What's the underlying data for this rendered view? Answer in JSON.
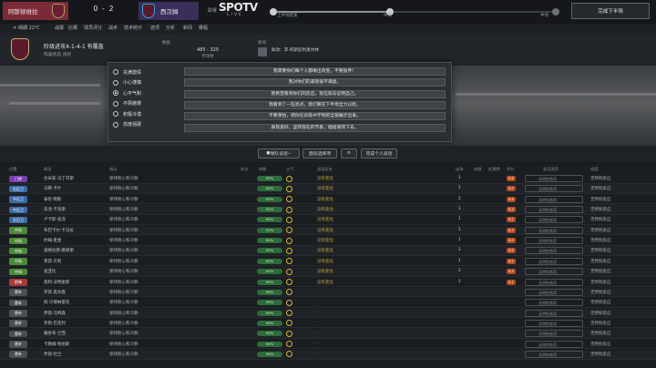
{
  "match": {
    "home_team": "阿斯顿维拉",
    "score": "0 - 2",
    "away_team": "西汉姆",
    "competition": "联赛",
    "broadcaster_top": "SPOTV",
    "broadcaster_bottom": "LIVE",
    "timeline": {
      "first_half": "上半场结束",
      "halftime": "中场",
      "second_half": "半场",
      "progress": 0.41
    },
    "continue_label": "完成下半场"
  },
  "info_bar": {
    "weather": "晴朗 22℃",
    "tabs": [
      "战报",
      "比赛",
      "球员评分",
      "战术",
      "技术统计",
      "选项",
      "分析",
      "新闻",
      "赛程"
    ]
  },
  "team_header": {
    "formation": "阶级进攻4-1-4-1 有覆盖",
    "subtitle": "阵容状态 良好",
    "stat_title": "数据",
    "stat_value": "485 - 325",
    "stat_sub": "传球数",
    "news_title": "新闻",
    "news_text": "助攻：李·阿斯彭利奥尔林"
  },
  "dialog": {
    "options": [
      {
        "label": "充满激情",
        "selected": false
      },
      {
        "label": "小心谨慎",
        "selected": false
      },
      {
        "label": "心平气和",
        "selected": true
      },
      {
        "label": "不屑傲慢",
        "selected": false
      },
      {
        "label": "积极冷漠",
        "selected": false
      },
      {
        "label": "态度强硬",
        "selected": false
      }
    ],
    "talk_lines": [
      "我需要你们每个人都做出改变，不要放弃！",
      "我对你们的表现很不满意。",
      "我希望看到你们的反应，现在就去证明自己。",
      "我看到了一些亮点，我们要在下半场全力以赴。",
      "不要害怕，把你在训练中学到的全部展示出来。",
      "表现良好，坚持现在的节奏，继续保持下去。"
    ]
  },
  "toolbar": {
    "team_talk_label": "球队谈话",
    "individual_label": "面谈选择项",
    "reset_label": "重置",
    "extra_label": "完成个人谈话"
  },
  "table": {
    "headers": [
      "位置",
      "球员",
      "指示",
      "评分",
      "体能",
      "士气",
      "谈话反应",
      "出场",
      "进球",
      "红黄牌",
      "评分",
      "谈话选项",
      "态度"
    ],
    "rows": [
      {
        "pos": "门将",
        "pos_color": "#7a3fb0",
        "name": "达米安·马丁内斯",
        "instruction": "保持耐心和冷静",
        "att": "95%",
        "reaction": "没有变化",
        "n1": "1",
        "badge": "6.8",
        "option": "无特别选项",
        "attitude": "无特别反应"
      },
      {
        "pos": "右后卫",
        "pos_color": "#3a6aa8",
        "name": "马蒂·卡什",
        "instruction": "保持耐心和冷静",
        "att": "94%",
        "reaction": "没有变化",
        "n1": "1",
        "badge": "6.5",
        "option": "无特别选项",
        "attitude": "无特别反应"
      },
      {
        "pos": "中后卫",
        "pos_color": "#3a6aa8",
        "name": "泰伦·明斯",
        "instruction": "保持耐心和冷静",
        "att": "93%",
        "reaction": "没有变化",
        "n1": "1",
        "badge": "6.6",
        "option": "无特别选项",
        "attitude": "无特别反应"
      },
      {
        "pos": "中后卫",
        "pos_color": "#3a6aa8",
        "name": "迭戈·卡洛斯",
        "instruction": "保持耐心和冷静",
        "att": "92%",
        "reaction": "没有变化",
        "n1": "1",
        "badge": "6.4",
        "option": "无特别选项",
        "attitude": "无特别反应"
      },
      {
        "pos": "左后卫",
        "pos_color": "#3a6aa8",
        "name": "卢卡斯·迪涅",
        "instruction": "保持耐心和冷静",
        "att": "95%",
        "reaction": "没有变化",
        "n1": "1",
        "badge": "6.7",
        "option": "无特别选项",
        "attitude": "无特别反应"
      },
      {
        "pos": "中场",
        "pos_color": "#4c8a3a",
        "name": "布巴卡尔·卡马拉",
        "instruction": "保持耐心和冷静",
        "att": "91%",
        "reaction": "没有变化",
        "n1": "1",
        "badge": "6.3",
        "option": "无特别选项",
        "attitude": "无特别反应"
      },
      {
        "pos": "中场",
        "pos_color": "#4c8a3a",
        "name": "约翰·麦金",
        "instruction": "保持耐心和冷静",
        "att": "90%",
        "reaction": "没有变化",
        "n1": "1",
        "badge": "6.9",
        "option": "无特别选项",
        "attitude": "无特别反应"
      },
      {
        "pos": "中场",
        "pos_color": "#4c8a3a",
        "name": "道格拉斯·路易斯",
        "instruction": "保持耐心和冷静",
        "att": "92%",
        "reaction": "没有变化",
        "n1": "1",
        "badge": "6.5",
        "option": "无特别选项",
        "attitude": "无特别反应"
      },
      {
        "pos": "中场",
        "pos_color": "#4c8a3a",
        "name": "莱昂·贝利",
        "instruction": "保持耐心和冷静",
        "att": "93%",
        "reaction": "没有变化",
        "n1": "1",
        "badge": "6.2",
        "option": "无特别选项",
        "attitude": "无特别反应"
      },
      {
        "pos": "中场",
        "pos_color": "#4c8a3a",
        "name": "迪亚比",
        "instruction": "保持耐心和冷静",
        "att": "94%",
        "reaction": "没有变化",
        "n1": "1",
        "badge": "6.4",
        "option": "无特别选项",
        "attitude": "无特别反应"
      },
      {
        "pos": "前锋",
        "pos_color": "#a83a3a",
        "name": "奥利·沃特金斯",
        "instruction": "保持耐心和冷静",
        "att": "90%",
        "reaction": "没有变化",
        "n1": "1",
        "badge": "6.1",
        "option": "无特别选项",
        "attitude": "无特别反应"
      },
      {
        "pos": "替补",
        "pos_color": "#4a4f55",
        "name": "罗宾·奥尔森",
        "instruction": "保持耐心和冷静",
        "att": "99%",
        "reaction": "-",
        "n1": "",
        "badge": "",
        "option": "无特别选项",
        "attitude": "无特别反应"
      },
      {
        "pos": "替补",
        "pos_color": "#4a4f55",
        "name": "扬·贝德纳雷克",
        "instruction": "保持耐心和冷静",
        "att": "99%",
        "reaction": "-",
        "n1": "",
        "badge": "",
        "option": "无特别选项",
        "attitude": "无特别反应"
      },
      {
        "pos": "替补",
        "pos_color": "#4a4f55",
        "name": "伊恩·马特森",
        "instruction": "保持耐心和冷静",
        "att": "99%",
        "reaction": "-",
        "n1": "",
        "badge": "",
        "option": "无特别选项",
        "attitude": "无特别反应"
      },
      {
        "pos": "替补",
        "pos_color": "#4a4f55",
        "name": "罗斯·巴克利",
        "instruction": "保持耐心和冷静",
        "att": "99%",
        "reaction": "-",
        "n1": "",
        "badge": "",
        "option": "无特别选项",
        "attitude": "无特别反应"
      },
      {
        "pos": "替补",
        "pos_color": "#4a4f55",
        "name": "雅各布·兰西",
        "instruction": "保持耐心和冷静",
        "att": "99%",
        "reaction": "-",
        "n1": "",
        "badge": "",
        "option": "无特别选项",
        "attitude": "无特别反应"
      },
      {
        "pos": "替补",
        "pos_color": "#4a4f55",
        "name": "卡勒姆·钱伯斯",
        "instruction": "保持耐心和冷静",
        "att": "99%",
        "reaction": "-",
        "n1": "",
        "badge": "",
        "option": "无特别选项",
        "attitude": "无特别反应"
      },
      {
        "pos": "替补",
        "pos_color": "#4a4f55",
        "name": "乔恩·杜兰",
        "instruction": "保持耐心和冷静",
        "att": "99%",
        "reaction": "-",
        "n1": "",
        "badge": "",
        "option": "无特别选项",
        "attitude": "无特别反应"
      }
    ]
  },
  "colors": {
    "accent": "#7d2a38",
    "away": "#3a2e5a",
    "fitness_green": "#2e6b3a",
    "badge_orange": "#b54a1e"
  }
}
